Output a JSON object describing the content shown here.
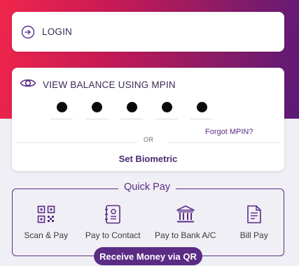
{
  "login": {
    "label": "LOGIN",
    "icon": "login-arrow-icon"
  },
  "balance": {
    "label": "VIEW BALANCE USING MPIN",
    "icon": "eye-icon",
    "pin_filled": 5,
    "forgot_label": "Forgot MPIN?",
    "or_label": "OR",
    "biometric_label": "Set Biometric"
  },
  "quick_pay": {
    "title": "Quick Pay",
    "items": [
      {
        "label": "Scan & Pay",
        "icon": "qr-code-icon"
      },
      {
        "label": "Pay to Contact",
        "icon": "contact-book-icon"
      },
      {
        "label": "Pay to Bank A/C",
        "icon": "bank-icon"
      },
      {
        "label": "Bill Pay",
        "icon": "bill-icon"
      }
    ]
  },
  "receive_qr": {
    "label": "Receive Money via QR"
  },
  "colors": {
    "brand": "#5a2c84",
    "gradient_start": "#f0264b",
    "gradient_end": "#5b1a78"
  }
}
